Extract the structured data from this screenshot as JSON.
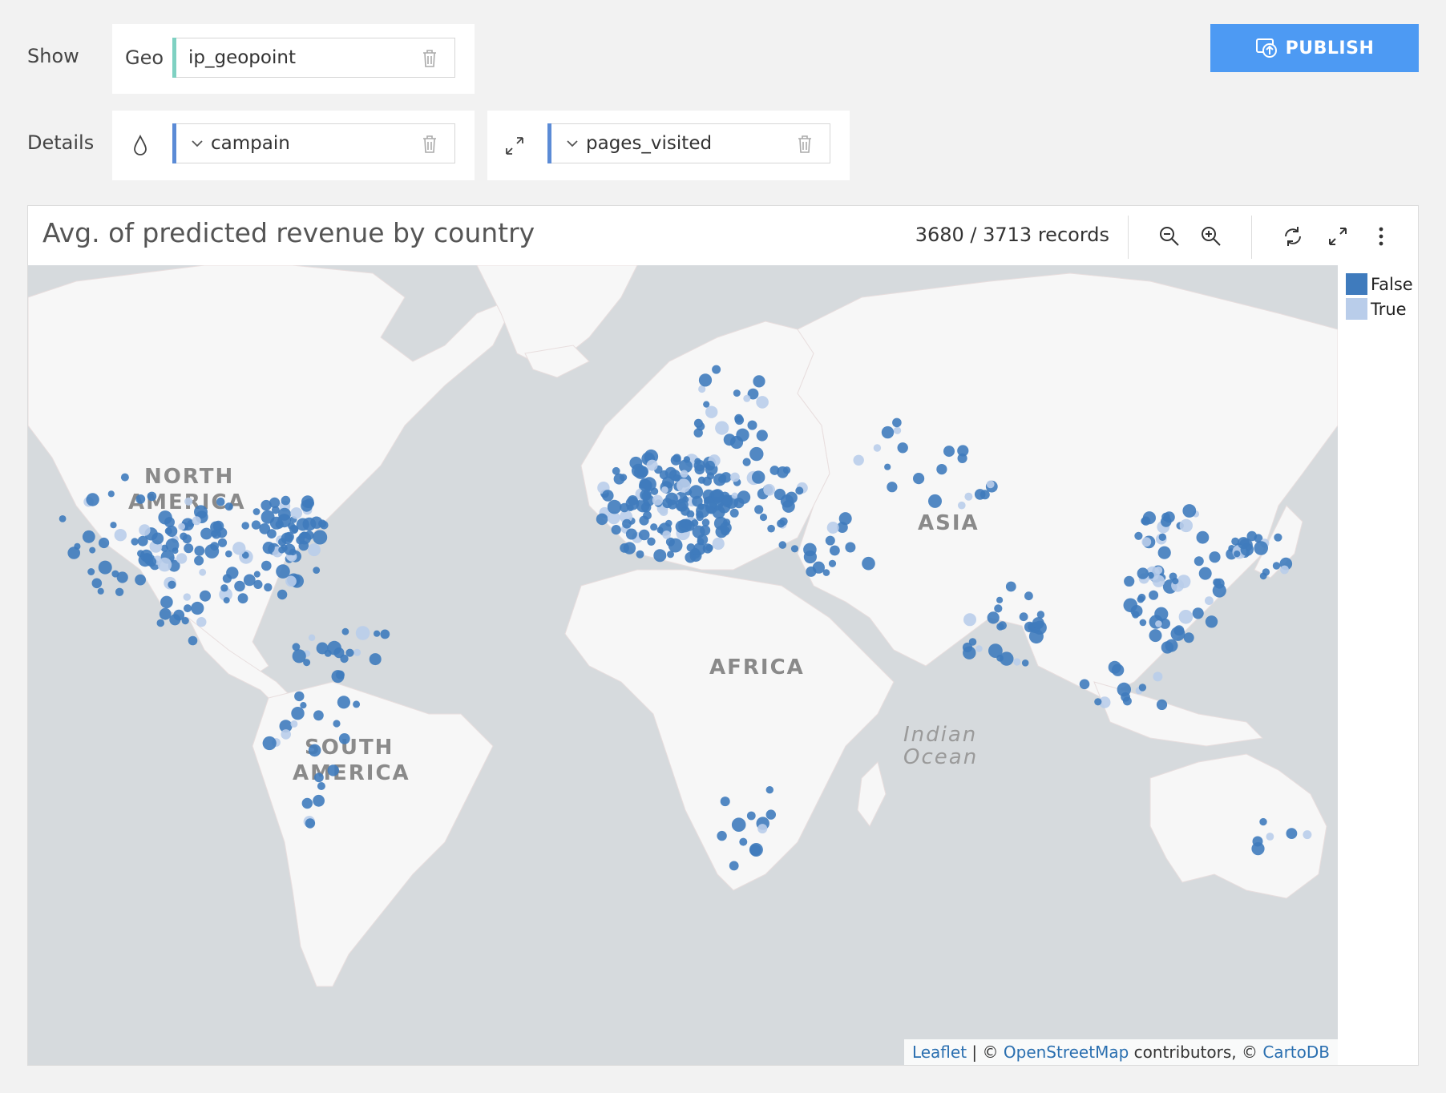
{
  "show_label": "Show",
  "details_label": "Details",
  "geo": {
    "label": "Geo",
    "value": "ip_geopoint",
    "accent": "#7fd1c2"
  },
  "color_field": {
    "value": "campain",
    "accent": "#5b8bd6"
  },
  "size_field": {
    "value": "pages_visited",
    "accent": "#5b8bd6"
  },
  "publish_label": "PUBLISH",
  "chart": {
    "title": "Avg. of predicted revenue by country",
    "records": "3680 / 3713 records",
    "toolbar": [
      "zoom-out-icon",
      "zoom-in-icon",
      "refresh-icon",
      "fullscreen-icon",
      "more-icon"
    ]
  },
  "legend": [
    {
      "label": "False",
      "color": "#3f7bbd"
    },
    {
      "label": "True",
      "color": "#b9cdea"
    }
  ],
  "map_labels": {
    "north_america_1": "NORTH",
    "north_america_2": "AMERICA",
    "south_america_1": "SOUTH",
    "south_america_2": "AMERICA",
    "asia": "ASIA",
    "africa": "AFRICA",
    "indian_ocean_1": "Indian",
    "indian_ocean_2": "Ocean"
  },
  "attribution": {
    "leaflet": "Leaflet",
    "sep1": " | © ",
    "osm": "OpenStreetMap",
    "contrib": " contributors, © ",
    "carto": "CartoDB"
  },
  "colors": {
    "land": "#f7f7f7",
    "water": "#d6dadd",
    "accent": "#4d9af3"
  }
}
